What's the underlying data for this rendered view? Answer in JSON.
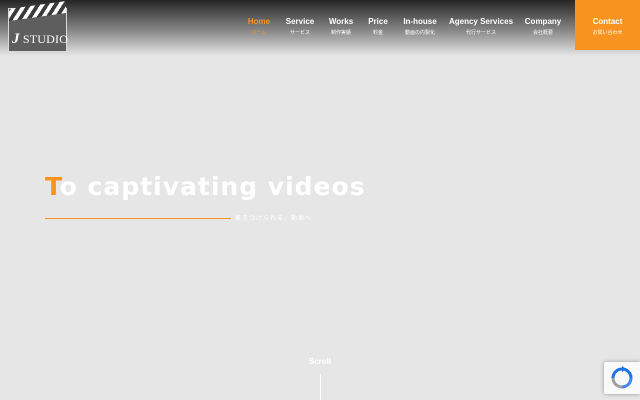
{
  "logo": {
    "initial": "J",
    "text": "STUDIO"
  },
  "nav": {
    "items": [
      {
        "en": "Home",
        "jp": "ホーム",
        "active": true
      },
      {
        "en": "Service",
        "jp": "サービス"
      },
      {
        "en": "Works",
        "jp": "制作実績"
      },
      {
        "en": "Price",
        "jp": "料金"
      },
      {
        "en": "In-house",
        "jp": "動画の内製化"
      },
      {
        "en": "Agency Services",
        "jp": "代行サービス"
      },
      {
        "en": "Company",
        "jp": "会社概要"
      }
    ],
    "contact": {
      "en": "Contact",
      "jp": "お問い合わせ"
    }
  },
  "hero": {
    "title_first": "T",
    "title_rest": "o captivating videos",
    "subtitle": "惹きつけられる、動画へ"
  },
  "scroll": {
    "label": "Scroll"
  },
  "colors": {
    "accent": "#f7931e",
    "background": "#e6e6e6"
  }
}
